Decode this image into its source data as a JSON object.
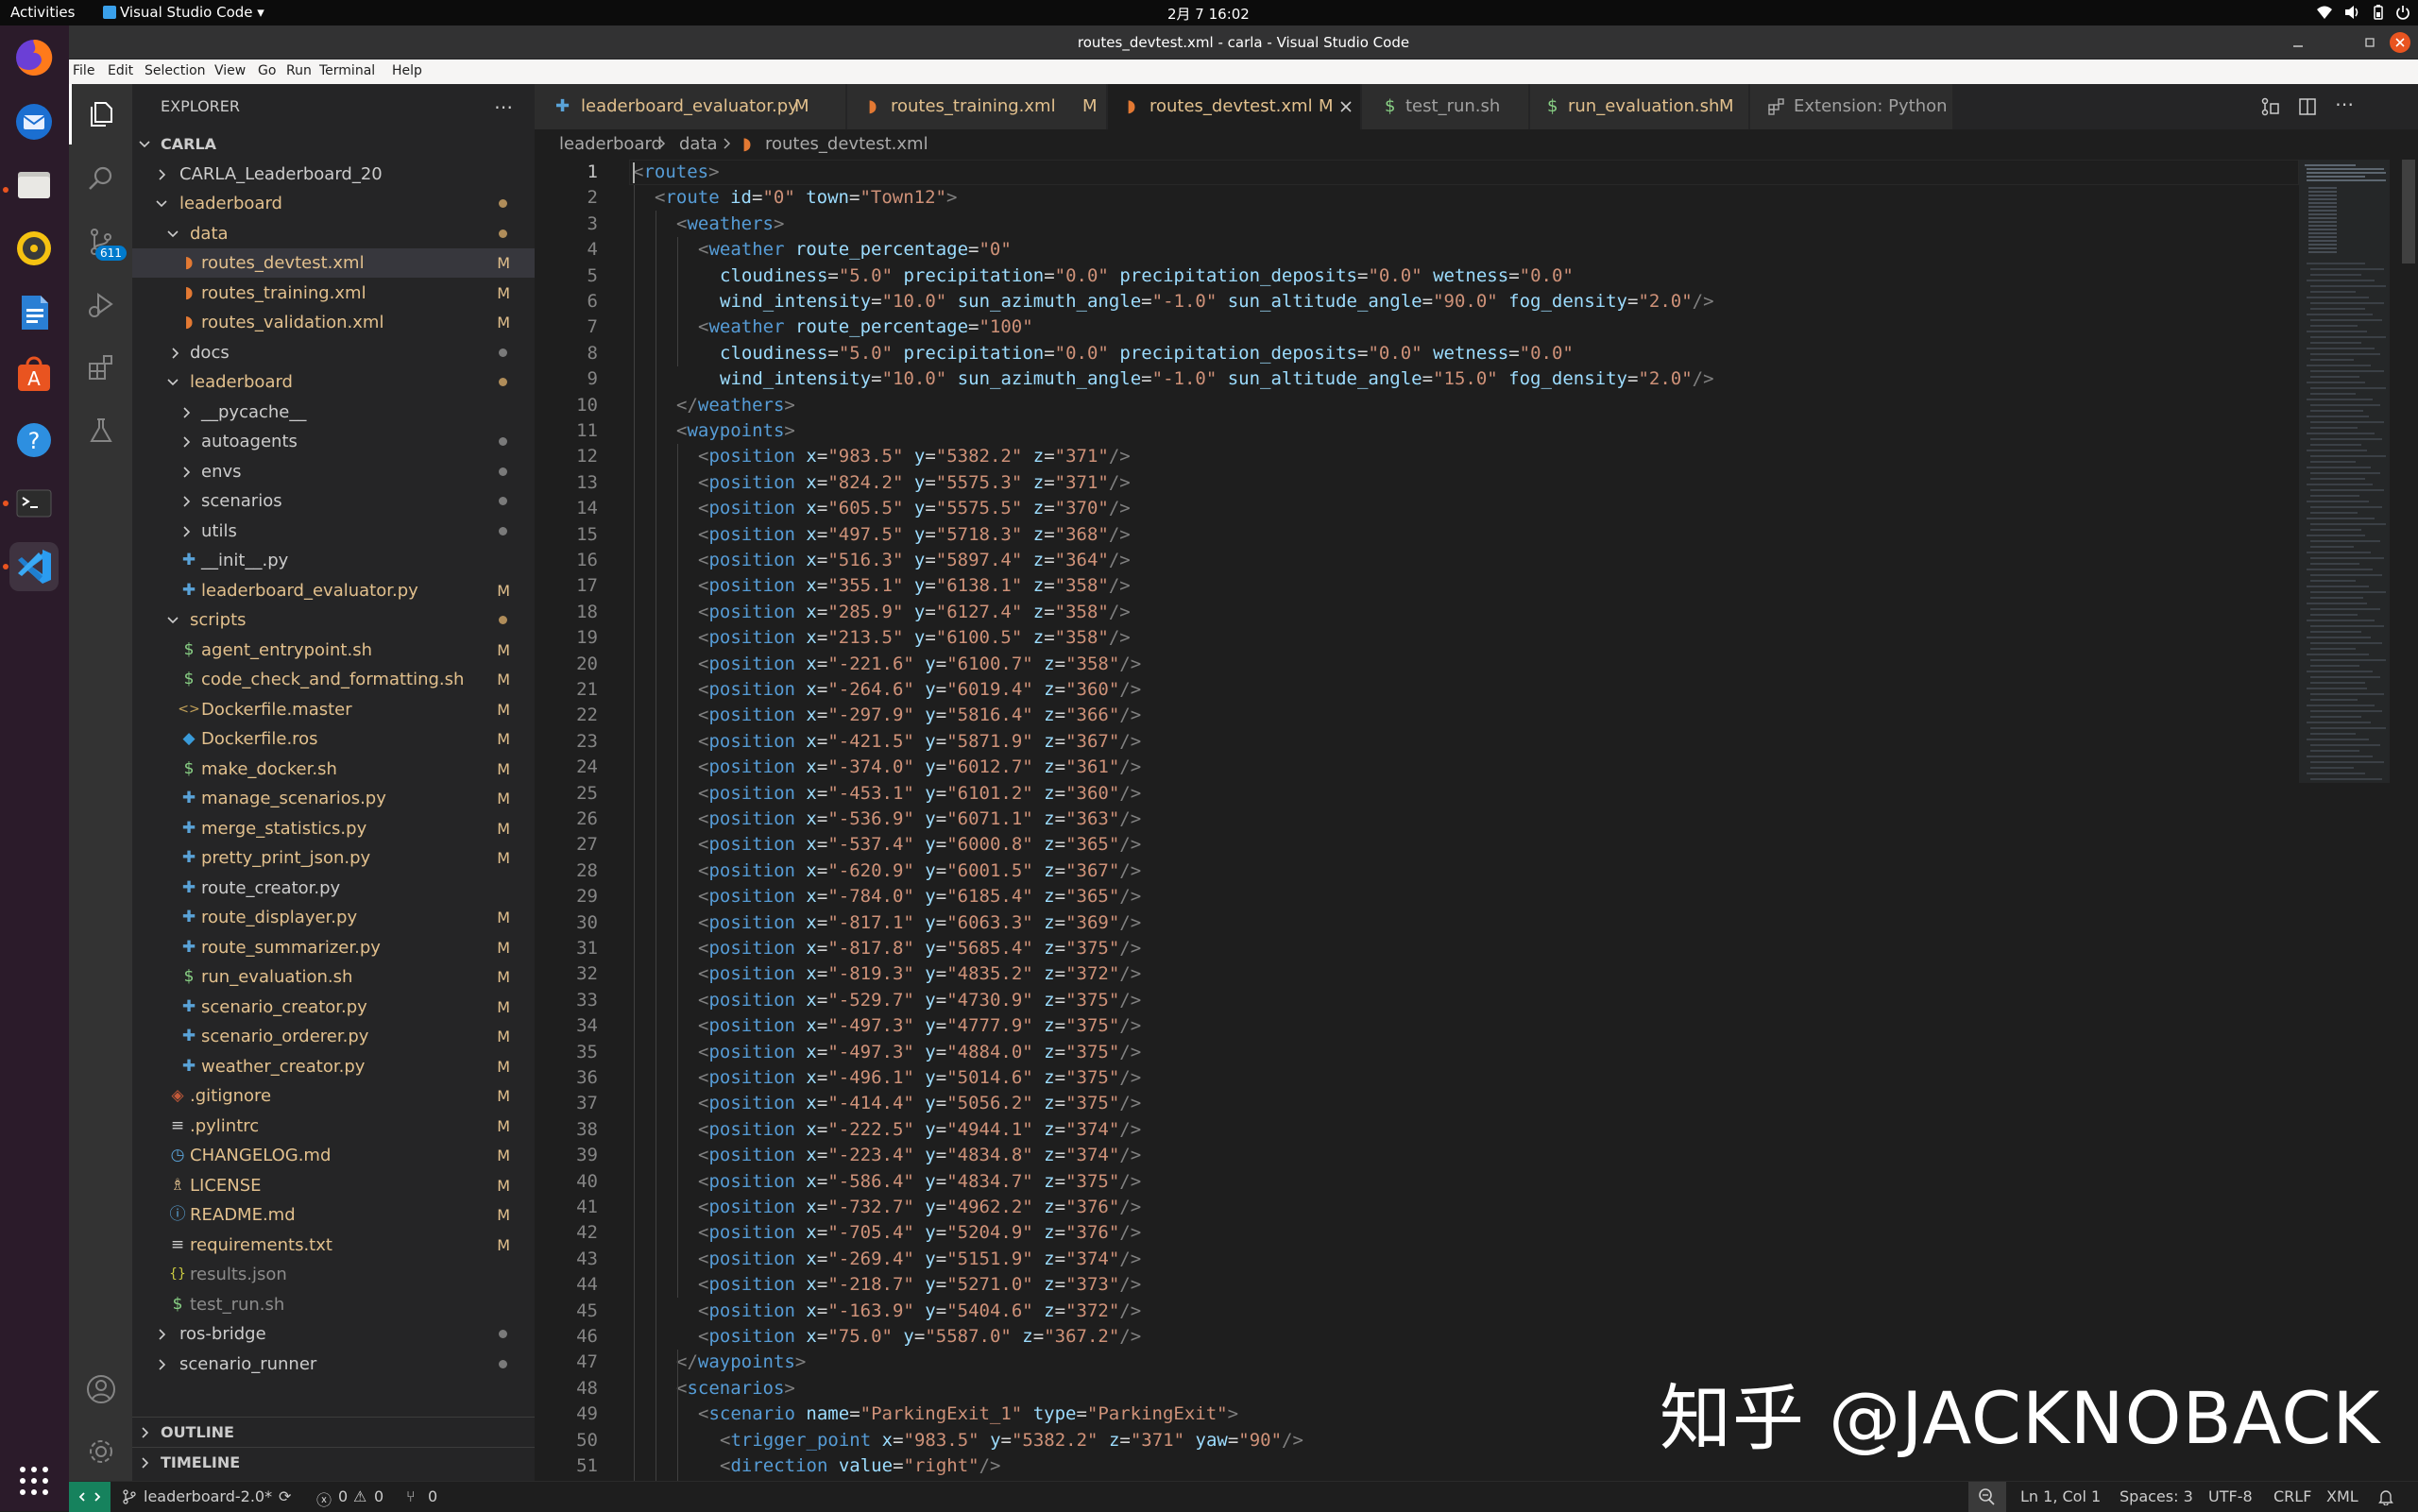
{
  "topbar": {
    "activities": "Activities",
    "app": "Visual Studio Code ▾",
    "clock": "2月 7  16:02"
  },
  "window": {
    "title": "routes_devtest.xml - carla - Visual Studio Code"
  },
  "menu": [
    "File",
    "Edit",
    "Selection",
    "View",
    "Go",
    "Run",
    "Terminal",
    "Help"
  ],
  "activity": {
    "scm_badge": "611"
  },
  "explorer": {
    "title": "EXPLORER",
    "root": "CARLA",
    "outline": "OUTLINE",
    "timeline": "TIMELINE",
    "items": [
      {
        "label": "CARLA_Leaderboard_20",
        "badge": ""
      },
      {
        "label": "leaderboard",
        "badge": ""
      },
      {
        "label": "data",
        "badge": ""
      },
      {
        "label": "routes_devtest.xml",
        "badge": "M"
      },
      {
        "label": "routes_training.xml",
        "badge": "M"
      },
      {
        "label": "routes_validation.xml",
        "badge": "M"
      },
      {
        "label": "docs",
        "badge": ""
      },
      {
        "label": "leaderboard",
        "badge": ""
      },
      {
        "label": "__pycache__",
        "badge": ""
      },
      {
        "label": "autoagents",
        "badge": ""
      },
      {
        "label": "envs",
        "badge": ""
      },
      {
        "label": "scenarios",
        "badge": ""
      },
      {
        "label": "utils",
        "badge": ""
      },
      {
        "label": "__init__.py",
        "badge": ""
      },
      {
        "label": "leaderboard_evaluator.py",
        "badge": "M"
      },
      {
        "label": "scripts",
        "badge": ""
      },
      {
        "label": "agent_entrypoint.sh",
        "badge": "M"
      },
      {
        "label": "code_check_and_formatting.sh",
        "badge": "M"
      },
      {
        "label": "Dockerfile.master",
        "badge": "M"
      },
      {
        "label": "Dockerfile.ros",
        "badge": "M"
      },
      {
        "label": "make_docker.sh",
        "badge": "M"
      },
      {
        "label": "manage_scenarios.py",
        "badge": "M"
      },
      {
        "label": "merge_statistics.py",
        "badge": "M"
      },
      {
        "label": "pretty_print_json.py",
        "badge": "M"
      },
      {
        "label": "route_creator.py",
        "badge": ""
      },
      {
        "label": "route_displayer.py",
        "badge": "M"
      },
      {
        "label": "route_summarizer.py",
        "badge": "M"
      },
      {
        "label": "run_evaluation.sh",
        "badge": "M"
      },
      {
        "label": "scenario_creator.py",
        "badge": "M"
      },
      {
        "label": "scenario_orderer.py",
        "badge": "M"
      },
      {
        "label": "weather_creator.py",
        "badge": "M"
      },
      {
        "label": ".gitignore",
        "badge": "M"
      },
      {
        "label": ".pylintrc",
        "badge": "M"
      },
      {
        "label": "CHANGELOG.md",
        "badge": "M"
      },
      {
        "label": "LICENSE",
        "badge": "M"
      },
      {
        "label": "README.md",
        "badge": "M"
      },
      {
        "label": "requirements.txt",
        "badge": "M"
      },
      {
        "label": "results.json",
        "badge": ""
      },
      {
        "label": "test_run.sh",
        "badge": ""
      },
      {
        "label": "ros-bridge",
        "badge": ""
      },
      {
        "label": "scenario_runner",
        "badge": ""
      }
    ]
  },
  "tabs": [
    {
      "label": "leaderboard_evaluator.py",
      "badge": "M"
    },
    {
      "label": "routes_training.xml",
      "badge": "M"
    },
    {
      "label": "routes_devtest.xml",
      "badge": "M"
    },
    {
      "label": "test_run.sh",
      "badge": ""
    },
    {
      "label": "run_evaluation.sh",
      "badge": "M"
    },
    {
      "label": "Extension: Python",
      "badge": ""
    }
  ],
  "breadcrumb": [
    "leaderboard",
    "data",
    "routes_devtest.xml"
  ],
  "editor": {
    "lines": [
      {
        "n": "1",
        "code": "<routes>"
      },
      {
        "n": "2",
        "code": "  <route id=\"0\" town=\"Town12\">"
      },
      {
        "n": "3",
        "code": "    <weathers>"
      },
      {
        "n": "4",
        "code": "      <weather route_percentage=\"0\""
      },
      {
        "n": "5",
        "code": "        cloudiness=\"5.0\" precipitation=\"0.0\" precipitation_deposits=\"0.0\" wetness=\"0.0\""
      },
      {
        "n": "6",
        "code": "        wind_intensity=\"10.0\" sun_azimuth_angle=\"-1.0\" sun_altitude_angle=\"90.0\" fog_density=\"2.0\"/>"
      },
      {
        "n": "7",
        "code": "      <weather route_percentage=\"100\""
      },
      {
        "n": "8",
        "code": "        cloudiness=\"5.0\" precipitation=\"0.0\" precipitation_deposits=\"0.0\" wetness=\"0.0\""
      },
      {
        "n": "9",
        "code": "        wind_intensity=\"10.0\" sun_azimuth_angle=\"-1.0\" sun_altitude_angle=\"15.0\" fog_density=\"2.0\"/>"
      },
      {
        "n": "10",
        "code": "    </weathers>"
      },
      {
        "n": "11",
        "code": "    <waypoints>"
      },
      {
        "n": "12",
        "code": "      <position x=\"983.5\" y=\"5382.2\" z=\"371\"/>"
      },
      {
        "n": "13",
        "code": "      <position x=\"824.2\" y=\"5575.3\" z=\"371\"/>"
      },
      {
        "n": "14",
        "code": "      <position x=\"605.5\" y=\"5575.5\" z=\"370\"/>"
      },
      {
        "n": "15",
        "code": "      <position x=\"497.5\" y=\"5718.3\" z=\"368\"/>"
      },
      {
        "n": "16",
        "code": "      <position x=\"516.3\" y=\"5897.4\" z=\"364\"/>"
      },
      {
        "n": "17",
        "code": "      <position x=\"355.1\" y=\"6138.1\" z=\"358\"/>"
      },
      {
        "n": "18",
        "code": "      <position x=\"285.9\" y=\"6127.4\" z=\"358\"/>"
      },
      {
        "n": "19",
        "code": "      <position x=\"213.5\" y=\"6100.5\" z=\"358\"/>"
      },
      {
        "n": "20",
        "code": "      <position x=\"-221.6\" y=\"6100.7\" z=\"358\"/>"
      },
      {
        "n": "21",
        "code": "      <position x=\"-264.6\" y=\"6019.4\" z=\"360\"/>"
      },
      {
        "n": "22",
        "code": "      <position x=\"-297.9\" y=\"5816.4\" z=\"366\"/>"
      },
      {
        "n": "23",
        "code": "      <position x=\"-421.5\" y=\"5871.9\" z=\"367\"/>"
      },
      {
        "n": "24",
        "code": "      <position x=\"-374.0\" y=\"6012.7\" z=\"361\"/>"
      },
      {
        "n": "25",
        "code": "      <position x=\"-453.1\" y=\"6101.2\" z=\"360\"/>"
      },
      {
        "n": "26",
        "code": "      <position x=\"-536.9\" y=\"6071.1\" z=\"363\"/>"
      },
      {
        "n": "27",
        "code": "      <position x=\"-537.4\" y=\"6000.8\" z=\"365\"/>"
      },
      {
        "n": "28",
        "code": "      <position x=\"-620.9\" y=\"6001.5\" z=\"367\"/>"
      },
      {
        "n": "29",
        "code": "      <position x=\"-784.0\" y=\"6185.4\" z=\"365\"/>"
      },
      {
        "n": "30",
        "code": "      <position x=\"-817.1\" y=\"6063.3\" z=\"369\"/>"
      },
      {
        "n": "31",
        "code": "      <position x=\"-817.8\" y=\"5685.4\" z=\"375\"/>"
      },
      {
        "n": "32",
        "code": "      <position x=\"-819.3\" y=\"4835.2\" z=\"372\"/>"
      },
      {
        "n": "33",
        "code": "      <position x=\"-529.7\" y=\"4730.9\" z=\"375\"/>"
      },
      {
        "n": "34",
        "code": "      <position x=\"-497.3\" y=\"4777.9\" z=\"375\"/>"
      },
      {
        "n": "35",
        "code": "      <position x=\"-497.3\" y=\"4884.0\" z=\"375\"/>"
      },
      {
        "n": "36",
        "code": "      <position x=\"-496.1\" y=\"5014.6\" z=\"375\"/>"
      },
      {
        "n": "37",
        "code": "      <position x=\"-414.4\" y=\"5056.2\" z=\"375\"/>"
      },
      {
        "n": "38",
        "code": "      <position x=\"-222.5\" y=\"4944.1\" z=\"374\"/>"
      },
      {
        "n": "39",
        "code": "      <position x=\"-223.4\" y=\"4834.8\" z=\"374\"/>"
      },
      {
        "n": "40",
        "code": "      <position x=\"-586.4\" y=\"4834.7\" z=\"375\"/>"
      },
      {
        "n": "41",
        "code": "      <position x=\"-732.7\" y=\"4962.2\" z=\"376\"/>"
      },
      {
        "n": "42",
        "code": "      <position x=\"-705.4\" y=\"5204.9\" z=\"376\"/>"
      },
      {
        "n": "43",
        "code": "      <position x=\"-269.4\" y=\"5151.9\" z=\"374\"/>"
      },
      {
        "n": "44",
        "code": "      <position x=\"-218.7\" y=\"5271.0\" z=\"373\"/>"
      },
      {
        "n": "45",
        "code": "      <position x=\"-163.9\" y=\"5404.6\" z=\"372\"/>"
      },
      {
        "n": "46",
        "code": "      <position x=\"75.0\" y=\"5587.0\" z=\"367.2\"/>"
      },
      {
        "n": "47",
        "code": "    </waypoints>"
      },
      {
        "n": "48",
        "code": "    <scenarios>"
      },
      {
        "n": "49",
        "code": "      <scenario name=\"ParkingExit_1\" type=\"ParkingExit\">"
      },
      {
        "n": "50",
        "code": "        <trigger_point x=\"983.5\" y=\"5382.2\" z=\"371\" yaw=\"90\"/>"
      },
      {
        "n": "51",
        "code": "        <direction value=\"right\"/>"
      }
    ]
  },
  "statusbar": {
    "branch": "leaderboard-2.0*",
    "errors": "0",
    "warnings": "0",
    "ports": "0",
    "position": "Ln 1, Col 1",
    "spaces": "Spaces: 3",
    "encoding": "UTF-8",
    "eol": "CRLF",
    "language": "XML"
  },
  "watermark": "知乎 @JACKNOBACK",
  "colors": {
    "accent": "#007acc",
    "modified": "#e2c08d",
    "tag": "#569cd6",
    "attr": "#9cdcfe",
    "string": "#ce9178"
  }
}
